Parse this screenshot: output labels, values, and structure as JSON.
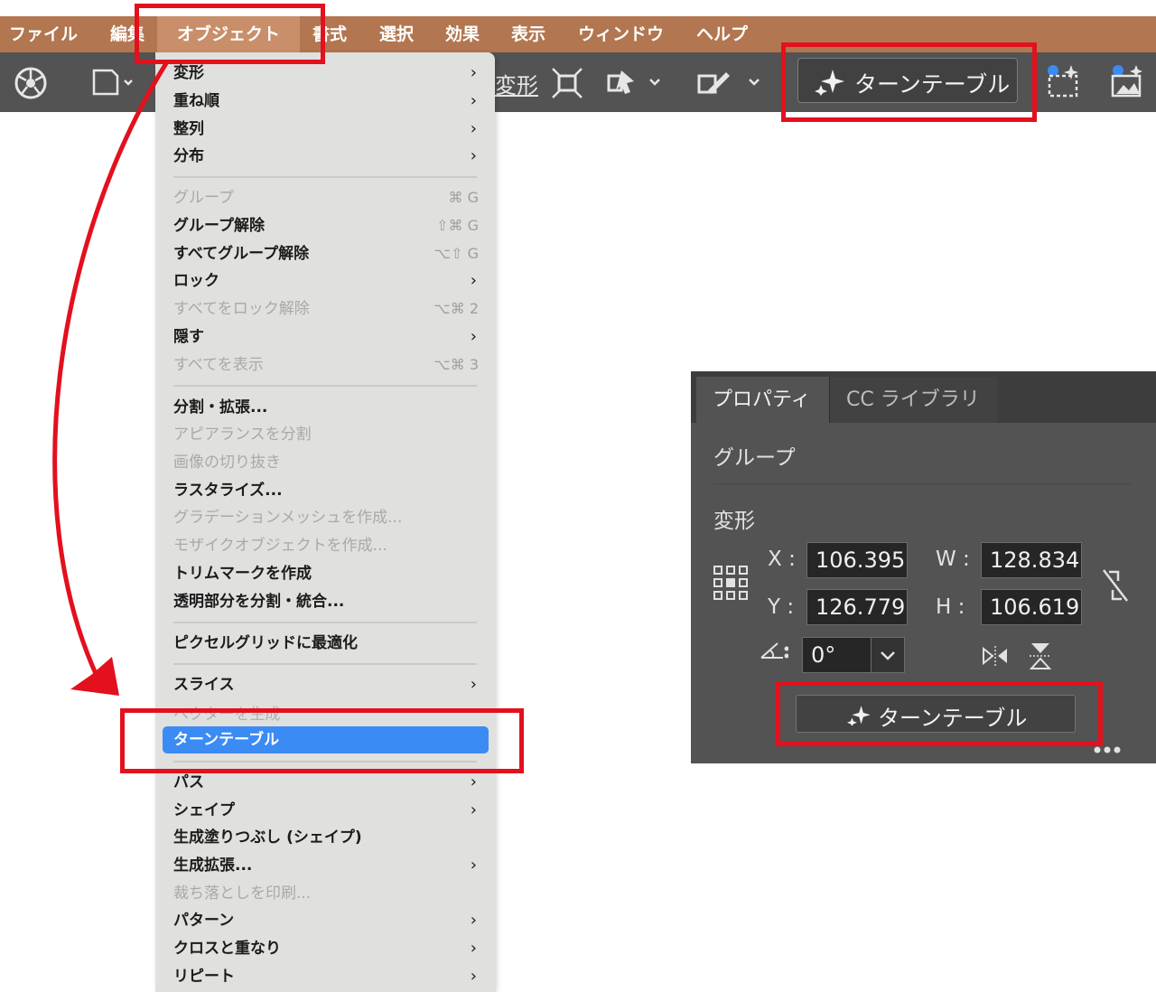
{
  "menubar": {
    "items": [
      "ファイル",
      "編集",
      "オブジェクト",
      "書式",
      "選択",
      "効果",
      "表示",
      "ウィンドウ",
      "ヘルプ"
    ]
  },
  "toolbar": {
    "partial_label": "変形",
    "turntable_label": "ターンテーブル"
  },
  "menu": {
    "items": [
      {
        "label": "変形",
        "submenu": "›"
      },
      {
        "label": "重ね順",
        "submenu": "›"
      },
      {
        "label": "整列",
        "submenu": "›"
      },
      {
        "label": "分布",
        "submenu": "›"
      },
      {
        "label": "グループ",
        "shortcut": "⌘ G"
      },
      {
        "label": "グループ解除",
        "shortcut": "⇧⌘ G"
      },
      {
        "label": "すべてグループ解除",
        "shortcut": "⌥⇧ G"
      },
      {
        "label": "ロック",
        "submenu": "›"
      },
      {
        "label": "すべてをロック解除",
        "shortcut": "⌥⌘ 2"
      },
      {
        "label": "隠す",
        "submenu": "›"
      },
      {
        "label": "すべてを表示",
        "shortcut": "⌥⌘ 3"
      },
      {
        "label": "分割・拡張..."
      },
      {
        "label": "アピアランスを分割"
      },
      {
        "label": "画像の切り抜き"
      },
      {
        "label": "ラスタライズ..."
      },
      {
        "label": "グラデーションメッシュを作成..."
      },
      {
        "label": "モザイクオブジェクトを作成..."
      },
      {
        "label": "トリムマークを作成"
      },
      {
        "label": "透明部分を分割・統合..."
      },
      {
        "label": "ピクセルグリッドに最適化"
      },
      {
        "label": "スライス",
        "submenu": "›"
      },
      {
        "label": "ベクターを生成"
      },
      {
        "label": "ターンテーブル"
      },
      {
        "label": "パス",
        "submenu": "›"
      },
      {
        "label": "シェイプ",
        "submenu": "›"
      },
      {
        "label": "生成塗りつぶし (シェイプ)"
      },
      {
        "label": "生成拡張...",
        "submenu": "›"
      },
      {
        "label": "裁ち落としを印刷..."
      },
      {
        "label": "パターン",
        "submenu": "›"
      },
      {
        "label": "クロスと重なり",
        "submenu": "›"
      },
      {
        "label": "リピート",
        "submenu": "›"
      }
    ]
  },
  "panel": {
    "tab_properties": "プロパティ",
    "tab_cc_libraries": "CC ライブラリ",
    "group_label": "グループ",
    "transform_label": "変形",
    "x_label": "X :",
    "x_value": "106.395",
    "y_label": "Y :",
    "y_value": "126.779",
    "w_label": "W :",
    "w_value": "128.834",
    "h_label": "H :",
    "h_value": "106.619",
    "angle_value": "0°",
    "turntable_label": "ターンテーブル"
  },
  "colors": {
    "menubar": "#b27650",
    "toolbar": "#535353",
    "menu_bg": "#e0e0de",
    "highlight": "#3b8bf5",
    "panel": "#535353",
    "annotation": "#e3101d"
  }
}
